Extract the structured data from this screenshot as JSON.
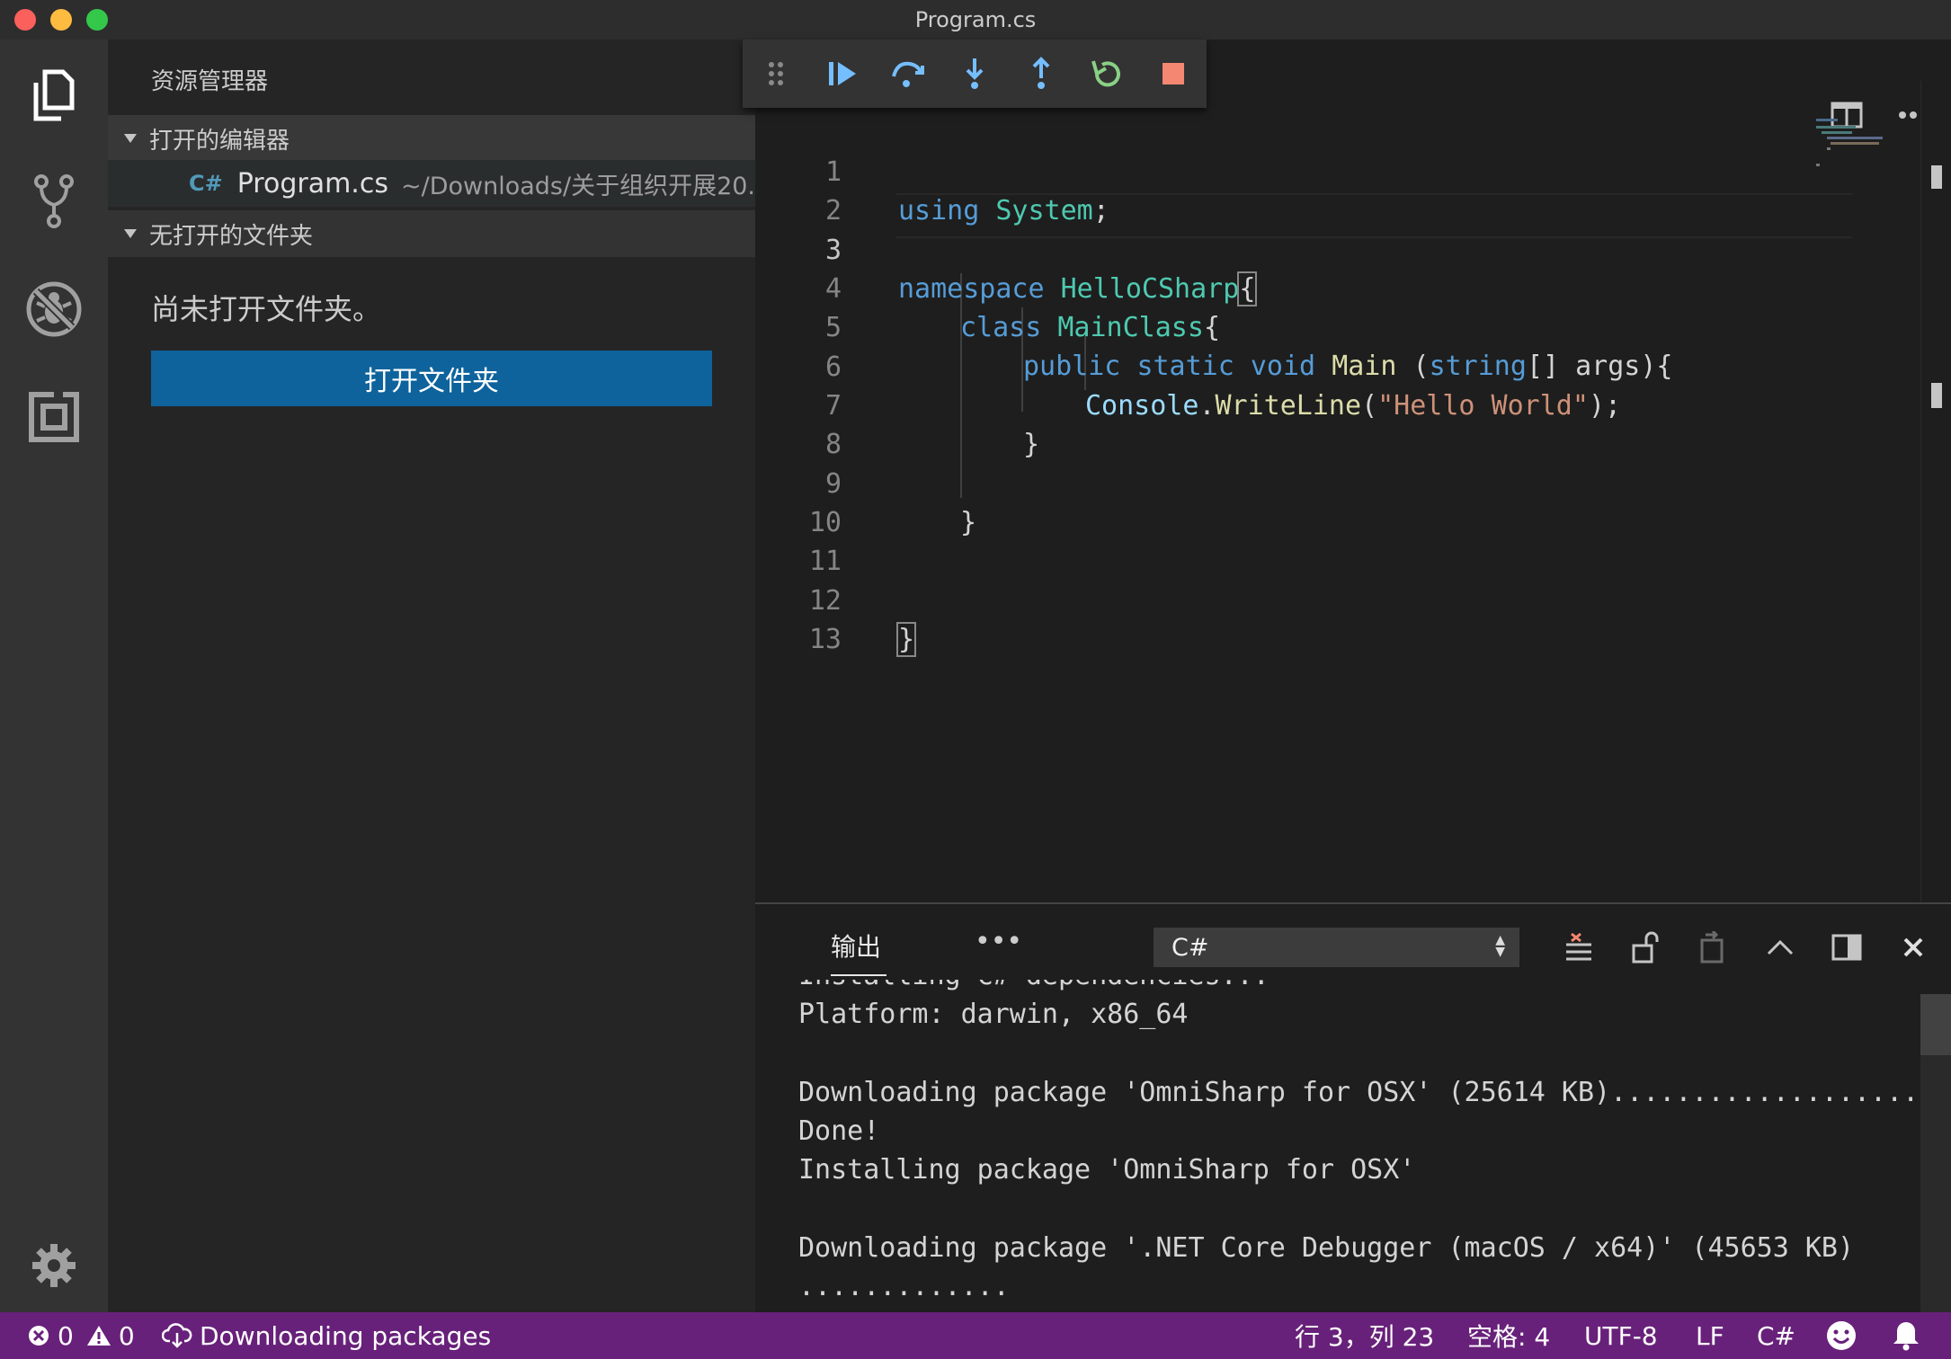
{
  "window": {
    "title": "Program.cs"
  },
  "activity_bar": {
    "items": [
      "explorer-icon",
      "source-control-icon",
      "debug-icon",
      "extensions-icon"
    ],
    "settings": "gear-icon"
  },
  "sidebar": {
    "header": "资源管理器",
    "open_editors": {
      "title": "打开的编辑器",
      "file": {
        "icon_label": "C#",
        "name": "Program.cs",
        "path": "~/Downloads/关于组织开展20..."
      }
    },
    "no_folder": {
      "title": "无打开的文件夹",
      "message": "尚未打开文件夹。",
      "button": "打开文件夹"
    }
  },
  "debug_toolbar": {
    "buttons": [
      "drag-handle-icon",
      "continue-icon",
      "step-over-icon",
      "step-into-icon",
      "step-out-icon",
      "restart-icon",
      "stop-icon"
    ]
  },
  "editor": {
    "active_line": 3,
    "lines": [
      {
        "n": "1"
      },
      {
        "n": "2"
      },
      {
        "n": "3"
      },
      {
        "n": "4"
      },
      {
        "n": "5"
      },
      {
        "n": "6"
      },
      {
        "n": "7"
      },
      {
        "n": "8"
      },
      {
        "n": "9"
      },
      {
        "n": "10"
      },
      {
        "n": "11"
      },
      {
        "n": "12"
      },
      {
        "n": "13"
      }
    ],
    "tokens": {
      "l1_kw": "using",
      "l1_ns": "System",
      "l1_semi": ";",
      "l3_kw": "namespace",
      "l3_name": "HelloCSharp",
      "l3_brace": "{",
      "l4_kw": "class",
      "l4_name": "MainClass",
      "l4_brace": "{",
      "l5_mod1": "public",
      "l5_mod2": "static",
      "l5_void": "void",
      "l5_fn": "Main",
      "l5_p1": " (",
      "l5_type": "string",
      "l5_p2": "[] ",
      "l5_arg": "args",
      "l5_p3": "){",
      "l6_cls": "Console",
      "l6_dot": ".",
      "l6_fn": "WriteLine",
      "l6_p1": "(",
      "l6_str": "\"Hello World\"",
      "l6_p2": ");",
      "l7_brace": "}",
      "l9_brace": "}",
      "l12_brace": "}"
    }
  },
  "panel": {
    "tab": "输出",
    "more": "•••",
    "channel": "C#",
    "actions": [
      "clear-output-icon",
      "lock-icon",
      "open-log-icon",
      "maximize-icon",
      "split-icon",
      "close-icon"
    ],
    "output_lines": [
      "Installing C# dependencies...",
      "Platform: darwin, x86_64",
      "",
      "Downloading package 'OmniSharp for OSX' (25614 KB)....................",
      "Done!",
      "Installing package 'OmniSharp for OSX'",
      "",
      "Downloading package '.NET Core Debugger (macOS / x64)' (45653 KB)",
      "............."
    ]
  },
  "status_bar": {
    "errors": "0",
    "warnings": "0",
    "task": "Downloading packages",
    "position": "行 3，列 23",
    "indent": "空格: 4",
    "encoding": "UTF-8",
    "eol": "LF",
    "language": "C#"
  },
  "colors": {
    "status_bar": "#68217a",
    "button": "#0e639c",
    "activity_bar": "#333333",
    "sidebar": "#252526",
    "editor": "#1e1e1e"
  }
}
